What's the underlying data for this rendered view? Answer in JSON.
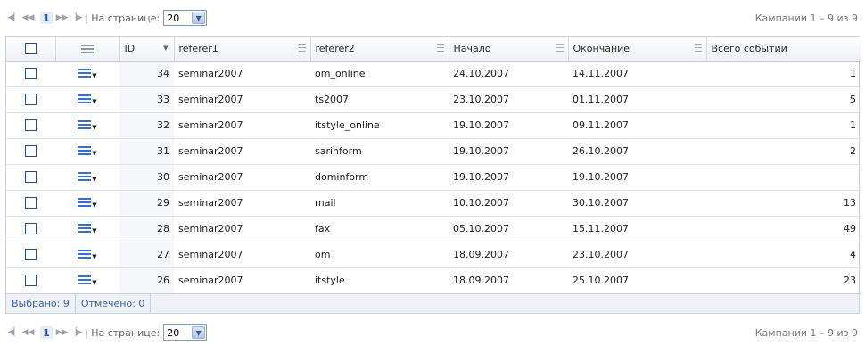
{
  "pager": {
    "current_page": "1",
    "per_page_label": "| На странице:",
    "per_page_value": "20",
    "summary": "Кампании 1 – 9 из 9"
  },
  "columns": {
    "id": "ID",
    "referer1": "referer1",
    "referer2": "referer2",
    "start": "Начало",
    "end": "Окончание",
    "total": "Всего событий"
  },
  "rows": [
    {
      "id": "34",
      "referer1": "seminar2007",
      "referer2": "om_online",
      "start": "24.10.2007",
      "end": "14.11.2007",
      "total": "1"
    },
    {
      "id": "33",
      "referer1": "seminar2007",
      "referer2": "ts2007",
      "start": "23.10.2007",
      "end": "01.11.2007",
      "total": "5"
    },
    {
      "id": "32",
      "referer1": "seminar2007",
      "referer2": "itstyle_online",
      "start": "19.10.2007",
      "end": "09.11.2007",
      "total": "1"
    },
    {
      "id": "31",
      "referer1": "seminar2007",
      "referer2": "sarinform",
      "start": "19.10.2007",
      "end": "26.10.2007",
      "total": "2"
    },
    {
      "id": "30",
      "referer1": "seminar2007",
      "referer2": "dominform",
      "start": "19.10.2007",
      "end": "19.10.2007",
      "total": ""
    },
    {
      "id": "29",
      "referer1": "seminar2007",
      "referer2": "mail",
      "start": "10.10.2007",
      "end": "30.10.2007",
      "total": "13"
    },
    {
      "id": "28",
      "referer1": "seminar2007",
      "referer2": "fax",
      "start": "05.10.2007",
      "end": "15.11.2007",
      "total": "49"
    },
    {
      "id": "27",
      "referer1": "seminar2007",
      "referer2": "om",
      "start": "18.09.2007",
      "end": "23.10.2007",
      "total": "4"
    },
    {
      "id": "26",
      "referer1": "seminar2007",
      "referer2": "itstyle",
      "start": "18.09.2007",
      "end": "25.10.2007",
      "total": "23"
    }
  ],
  "footer": {
    "selected": "Выбрано: 9",
    "marked": "Отмечено: 0"
  },
  "icons": {
    "first": "first-page-icon",
    "prev": "prev-page-icon",
    "next": "next-page-icon",
    "last": "last-page-icon",
    "row_menu": "row-menu-icon"
  },
  "colors": {
    "accent": "#3a6fc5",
    "header_border": "#c7d0dc",
    "footer_bg": "#eef2f7"
  }
}
